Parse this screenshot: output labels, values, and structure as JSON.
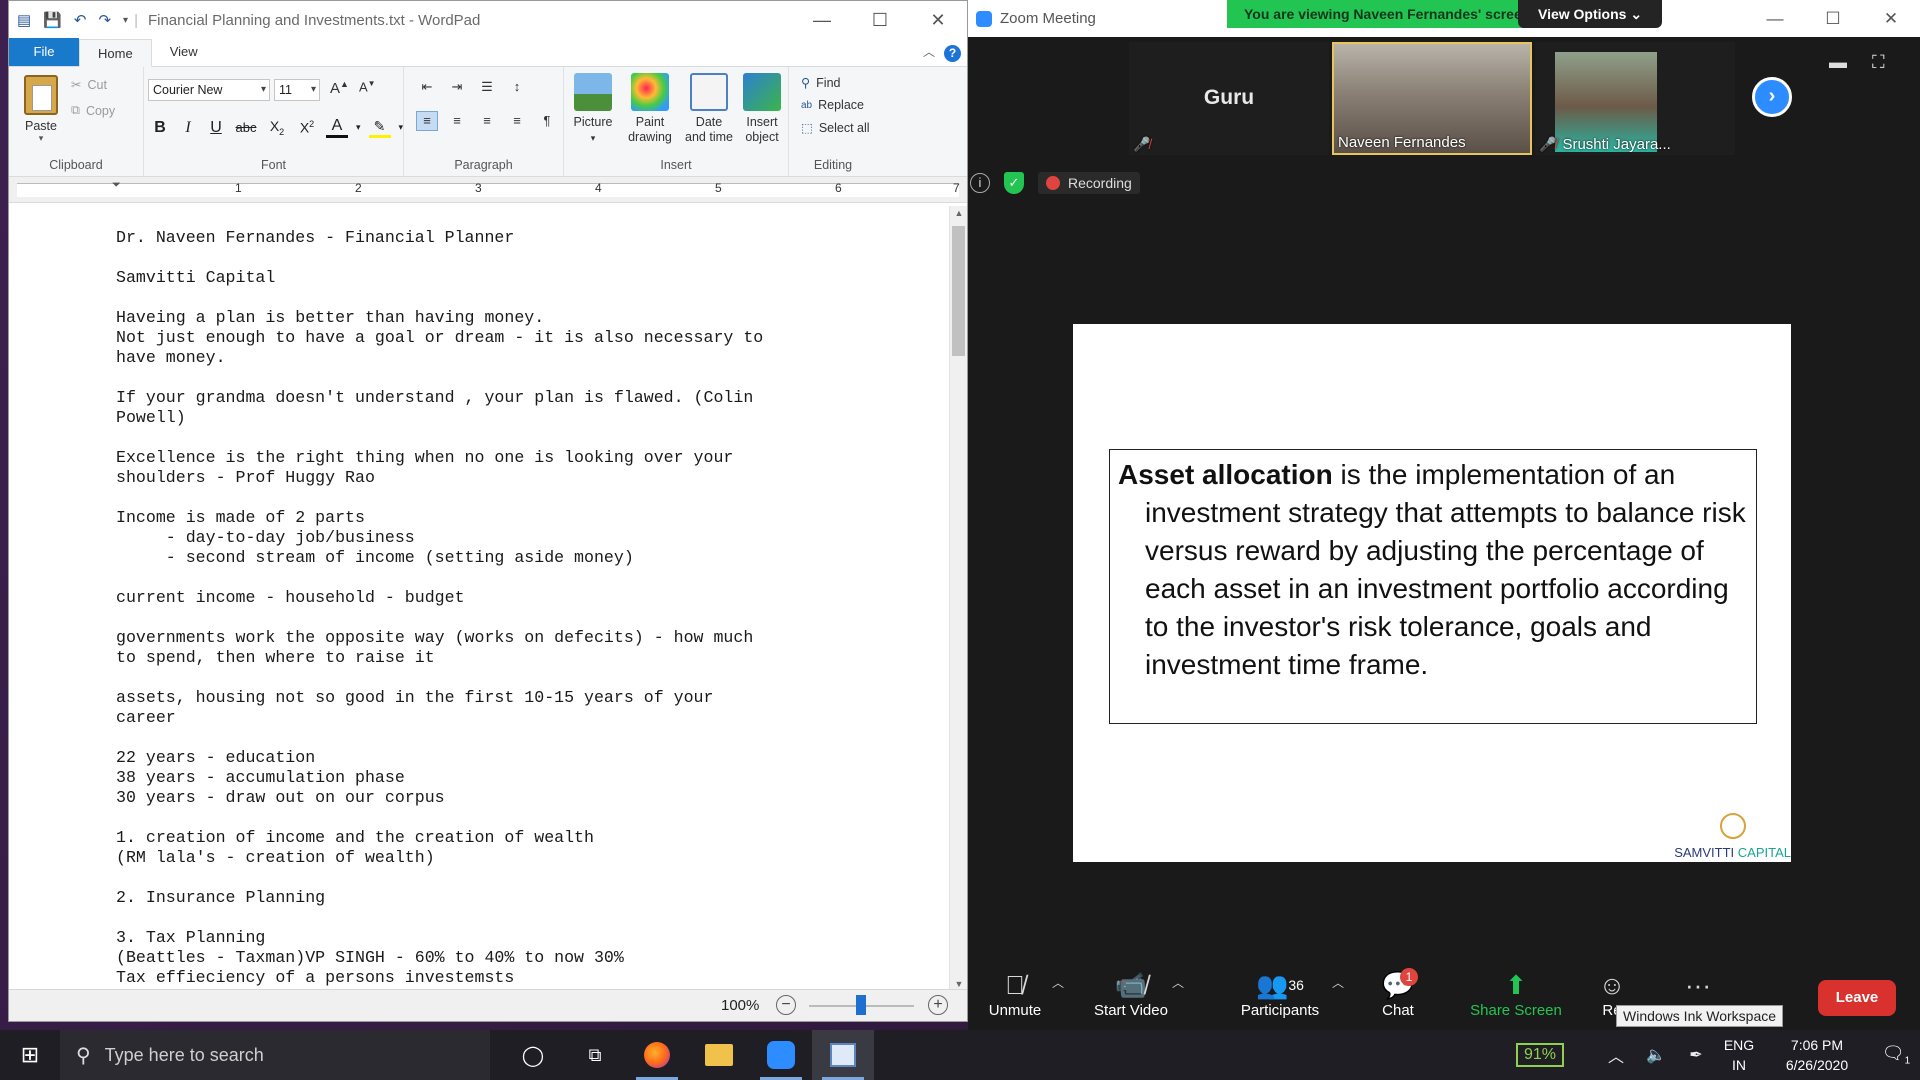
{
  "wordpad": {
    "title": "Financial Planning and Investments.txt - WordPad",
    "tabs": {
      "file": "File",
      "home": "Home",
      "view": "View"
    },
    "clipboard": {
      "paste": "Paste",
      "cut": "Cut",
      "copy": "Copy",
      "group": "Clipboard"
    },
    "font": {
      "name": "Courier New",
      "size": "11",
      "group": "Font"
    },
    "paragraph": {
      "group": "Paragraph"
    },
    "insert": {
      "group": "Insert",
      "picture": "Picture",
      "paint_drawing": "Paint drawing",
      "date_time": "Date and time",
      "insert_object": "Insert object"
    },
    "editing": {
      "group": "Editing",
      "find": "Find",
      "replace": "Replace",
      "select_all": "Select all"
    },
    "ruler_marks": [
      "1",
      "2",
      "3",
      "4",
      "5",
      "6",
      "7"
    ],
    "document_text": "Dr. Naveen Fernandes - Financial Planner\n\nSamvitti Capital\n\nHaveing a plan is better than having money.\nNot just enough to have a goal or dream - it is also necessary to\nhave money.\n\nIf your grandma doesn't understand , your plan is flawed. (Colin\nPowell)\n\nExcellence is the right thing when no one is looking over your\nshoulders - Prof Huggy Rao\n\nIncome is made of 2 parts\n     - day-to-day job/business\n     - second stream of income (setting aside money)\n\ncurrent income - household - budget\n\ngovernments work the opposite way (works on defecits) - how much\nto spend, then where to raise it\n\nassets, housing not so good in the first 10-15 years of your\ncareer\n\n22 years - education\n38 years - accumulation phase\n30 years - draw out on our corpus\n\n1. creation of income and the creation of wealth\n(RM lala's - creation of wealth)\n\n2. Insurance Planning\n\n3. Tax Planning\n(Beattles - Taxman)VP SINGH - 60% to 40% to now 30%\nTax effieciency of a persons investemsts",
    "zoom_level": "100%"
  },
  "zoom": {
    "title": "Zoom Meeting",
    "viewing_banner": "You are viewing Naveen Fernandes' screen",
    "view_options": "View Options",
    "participants": [
      {
        "name": "Guru",
        "muted": true
      },
      {
        "name": "Naveen Fernandes",
        "muted": false
      },
      {
        "name": "Srushti Jayara...",
        "muted": true
      }
    ],
    "recording": "Recording",
    "slide": {
      "term": "Asset allocation",
      "definition": " is the implementation of an investment strategy that attempts to balance risk versus reward by adjusting the percentage of each asset in an investment portfolio according to the investor's risk tolerance, goals and investment time frame.",
      "logo_text_a": "SAMVITTI",
      "logo_text_b": "CAPITAL"
    },
    "toolbar": {
      "unmute": "Unmute",
      "start_video": "Start Video",
      "participants": "Participants",
      "participants_count": "36",
      "chat": "Chat",
      "chat_badge": "1",
      "share_screen": "Share Screen",
      "reactions": "Re",
      "leave": "Leave"
    },
    "tooltip": "Windows Ink Workspace"
  },
  "taskbar": {
    "search_placeholder": "Type here to search",
    "battery": "91%",
    "lang_line1": "ENG",
    "lang_line2": "IN",
    "time": "7:06 PM",
    "date": "6/26/2020",
    "notification_count": "1"
  }
}
